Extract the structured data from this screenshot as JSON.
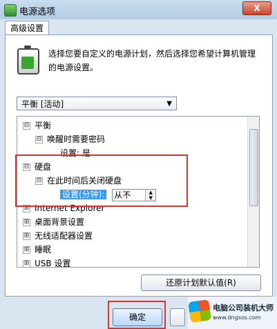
{
  "window": {
    "title": "电源选项",
    "close_label": "X"
  },
  "tabs": [
    {
      "label": "高级设置"
    }
  ],
  "description": "选择您要自定义的电源计划，然后选择您希望计算机管理的电源设置。",
  "plan_select": {
    "value": "平衡 [活动]"
  },
  "tree": {
    "items": [
      {
        "label": "平衡",
        "expander": "⊟"
      },
      {
        "label": "唤醒时需要密码",
        "expander": "⊟"
      },
      {
        "label": "设置: 是",
        "expander": ""
      },
      {
        "label": "硬盘",
        "expander": "⊟"
      },
      {
        "label": "在此时间后关闭硬盘",
        "expander": "⊟"
      },
      {
        "label": "设置(分钟):",
        "expander": ""
      },
      {
        "label": "Internet Explorer",
        "expander": "⊞"
      },
      {
        "label": "桌面背景设置",
        "expander": "⊞"
      },
      {
        "label": "无线适配器设置",
        "expander": "⊞"
      },
      {
        "label": "睡眠",
        "expander": "⊞"
      },
      {
        "label": "USB 设置",
        "expander": "⊞"
      }
    ],
    "spinner_value": "从不"
  },
  "buttons": {
    "restore": "还原计划默认值(R)",
    "ok": "确定"
  },
  "watermark": {
    "main": "电脑公司装机大师",
    "sub": "www.dngsos.com"
  },
  "colors": {
    "highlight_red": "#e0312a",
    "selection_blue": "#3399ff"
  }
}
